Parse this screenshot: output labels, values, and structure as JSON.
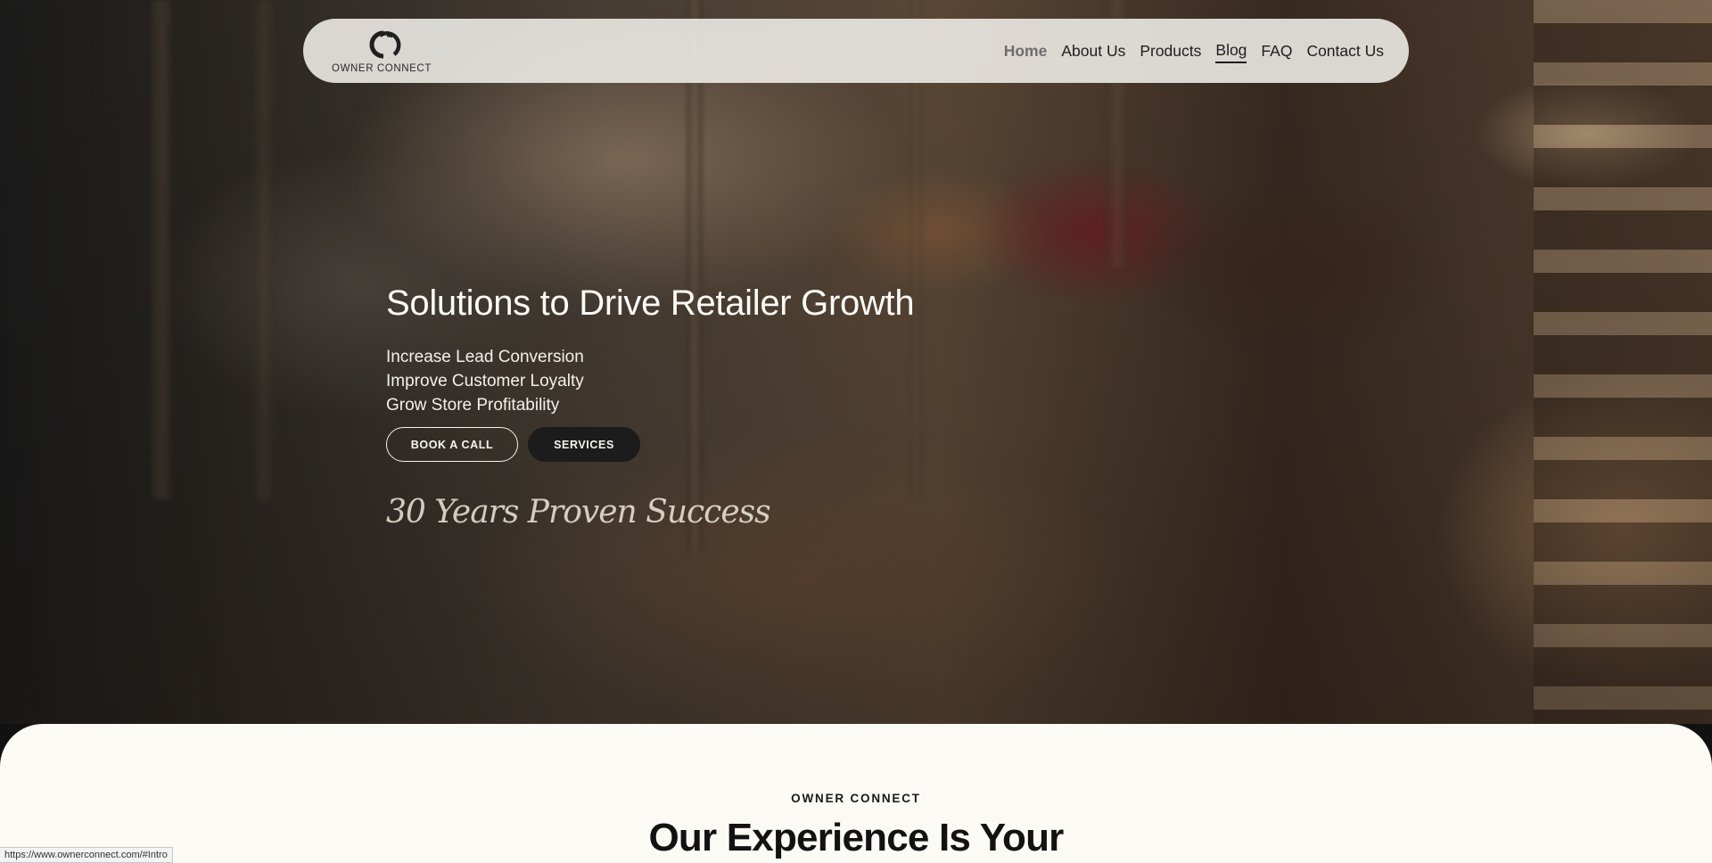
{
  "brand": {
    "logo_text": "OWNER CONNECT",
    "logo_color": "#1f1f1f"
  },
  "nav": {
    "items": [
      {
        "label": "Home",
        "state": "active"
      },
      {
        "label": "About Us",
        "state": "default"
      },
      {
        "label": "Products",
        "state": "default"
      },
      {
        "label": "Blog",
        "state": "hover"
      },
      {
        "label": "FAQ",
        "state": "default"
      },
      {
        "label": "Contact Us",
        "state": "default"
      }
    ]
  },
  "hero": {
    "title": "Solutions to Drive Retailer Growth",
    "bullets": [
      "Increase Lead Conversion",
      "Improve Customer Loyalty",
      "Grow Store Profitability"
    ],
    "primary_button": "BOOK A CALL",
    "secondary_button": "SERVICES",
    "tagline": "30 Years Proven Success"
  },
  "section": {
    "eyebrow": "OWNER CONNECT",
    "title_pre": "Our ",
    "title_bold": "Experience",
    "title_post": " Is Your"
  },
  "status_bar": {
    "url": "https://www.ownerconnect.com/#Intro"
  },
  "colors": {
    "navbar_bg": "#ECEAE4",
    "section_bg": "#FBFAF5",
    "dark_button": "#1C1C1C"
  }
}
